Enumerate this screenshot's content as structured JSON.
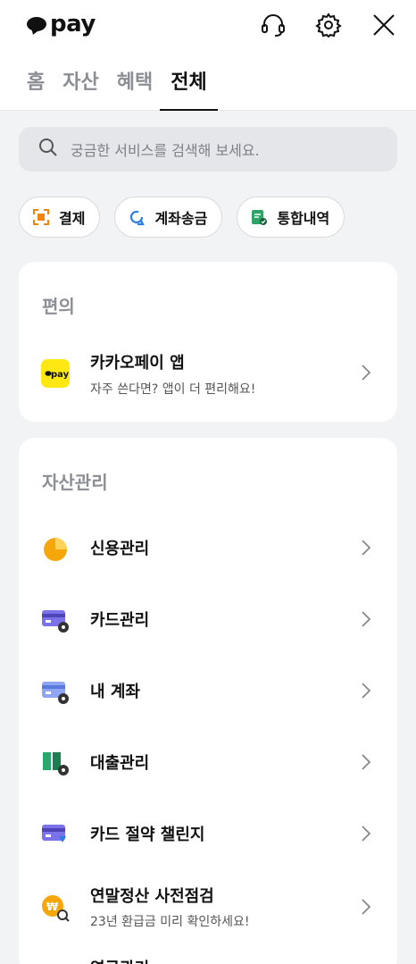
{
  "header": {
    "logo_text": "pay",
    "icons": [
      "headset-icon",
      "gear-icon",
      "close-icon"
    ]
  },
  "tabs": [
    {
      "label": "홈",
      "active": false
    },
    {
      "label": "자산",
      "active": false
    },
    {
      "label": "혜택",
      "active": false
    },
    {
      "label": "전체",
      "active": true
    }
  ],
  "search": {
    "placeholder": "궁금한 서비스를 검색해 보세요."
  },
  "chips": [
    {
      "label": "결제",
      "icon": "scan-icon",
      "color": "#f5820a"
    },
    {
      "label": "계좌송금",
      "icon": "transfer-icon",
      "color": "#2b7be4"
    },
    {
      "label": "통합내역",
      "icon": "history-icon",
      "color": "#2fa368"
    }
  ],
  "convenience": {
    "title": "편의",
    "items": [
      {
        "title": "카카오페이 앱",
        "subtitle": "자주 쓴다면? 앱이 더 편리해요!",
        "icon": "kakaopay-app-icon"
      }
    ]
  },
  "asset_mgmt": {
    "title": "자산관리",
    "items": [
      {
        "title": "신용관리",
        "subtitle": "",
        "icon": "credit-gauge-icon"
      },
      {
        "title": "카드관리",
        "subtitle": "",
        "icon": "card-settings-icon"
      },
      {
        "title": "내 계좌",
        "subtitle": "",
        "icon": "account-settings-icon"
      },
      {
        "title": "대출관리",
        "subtitle": "",
        "icon": "loan-settings-icon"
      },
      {
        "title": "카드 절약 챌린지",
        "subtitle": "",
        "icon": "card-challenge-icon"
      },
      {
        "title": "연말정산 사전점검",
        "subtitle": "23년 환급금 미리 확인하세요!",
        "icon": "tax-check-icon"
      },
      {
        "title": "연금관리",
        "subtitle": "",
        "icon": "pension-icon"
      }
    ]
  },
  "colors": {
    "kakao_yellow": "#ffe812",
    "accent_orange": "#f5a70a",
    "card_purple": "#7b72e9"
  }
}
